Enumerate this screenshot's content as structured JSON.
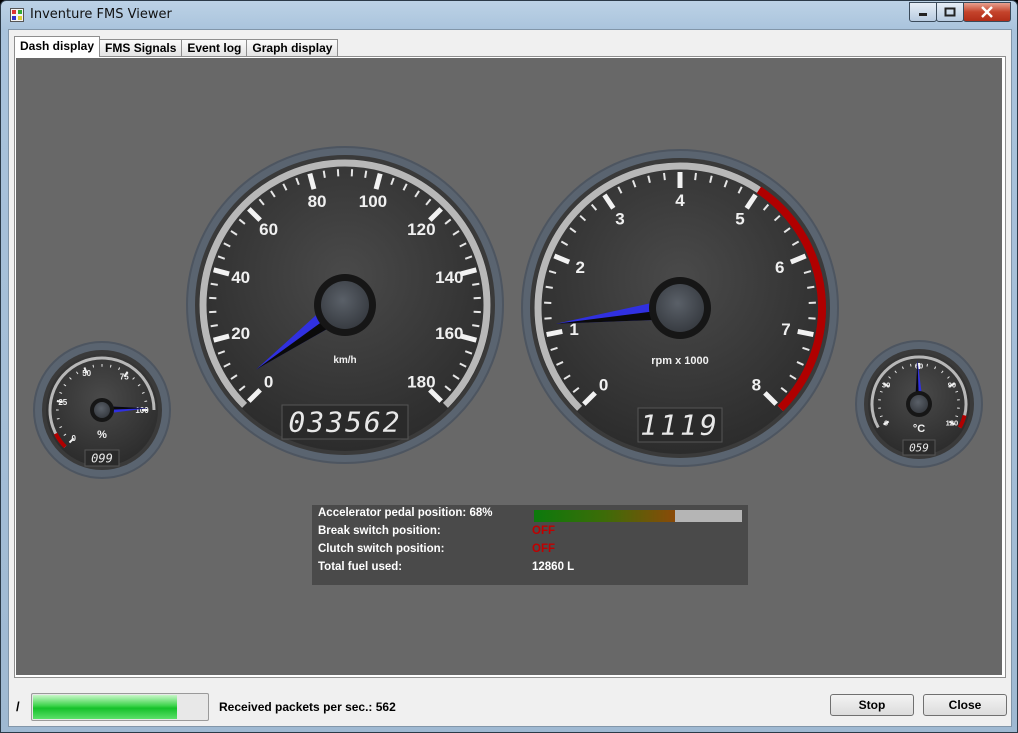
{
  "window": {
    "title": "Inventure FMS Viewer"
  },
  "tabs": [
    "Dash display",
    "FMS Signals",
    "Event log",
    "Graph display"
  ],
  "speedometer": {
    "ticks": [
      "0",
      "20",
      "40",
      "60",
      "80",
      "100",
      "120",
      "140",
      "160",
      "180"
    ],
    "unit": "km/h",
    "odometer": "033562",
    "value": 6
  },
  "tachometer": {
    "ticks": [
      "0",
      "1",
      "2",
      "3",
      "4",
      "5",
      "6",
      "7",
      "8"
    ],
    "unit": "rpm x 1000",
    "display": "1119",
    "value": 1.119,
    "redline": [
      5,
      8
    ]
  },
  "fuel_gauge": {
    "ticks": [
      "0",
      "25",
      "50",
      "75",
      "100"
    ],
    "unit": "%",
    "display": "099",
    "value": 99
  },
  "temp_gauge": {
    "ticks": [
      "0",
      "30",
      "60",
      "90",
      "120"
    ],
    "unit": "°C",
    "display": "059",
    "value": 59
  },
  "info": {
    "accel_label": "Accelerator pedal position: 68%",
    "accel_value": 0.68,
    "break_label": "Break switch position:",
    "break_value": "OFF",
    "clutch_label": "Clutch switch position:",
    "clutch_value": "OFF",
    "fuel_label": "Total fuel used:",
    "fuel_value": "12860 L"
  },
  "status": {
    "indicator": "/",
    "progress": 0.83,
    "packets_text": "Received packets per sec.: 562"
  },
  "buttons": {
    "stop": "Stop",
    "close": "Close"
  },
  "colors": {
    "needle": "#3030e0",
    "redline": "#b00000",
    "off_text": "#c00000",
    "dash_bg": "#686868"
  }
}
